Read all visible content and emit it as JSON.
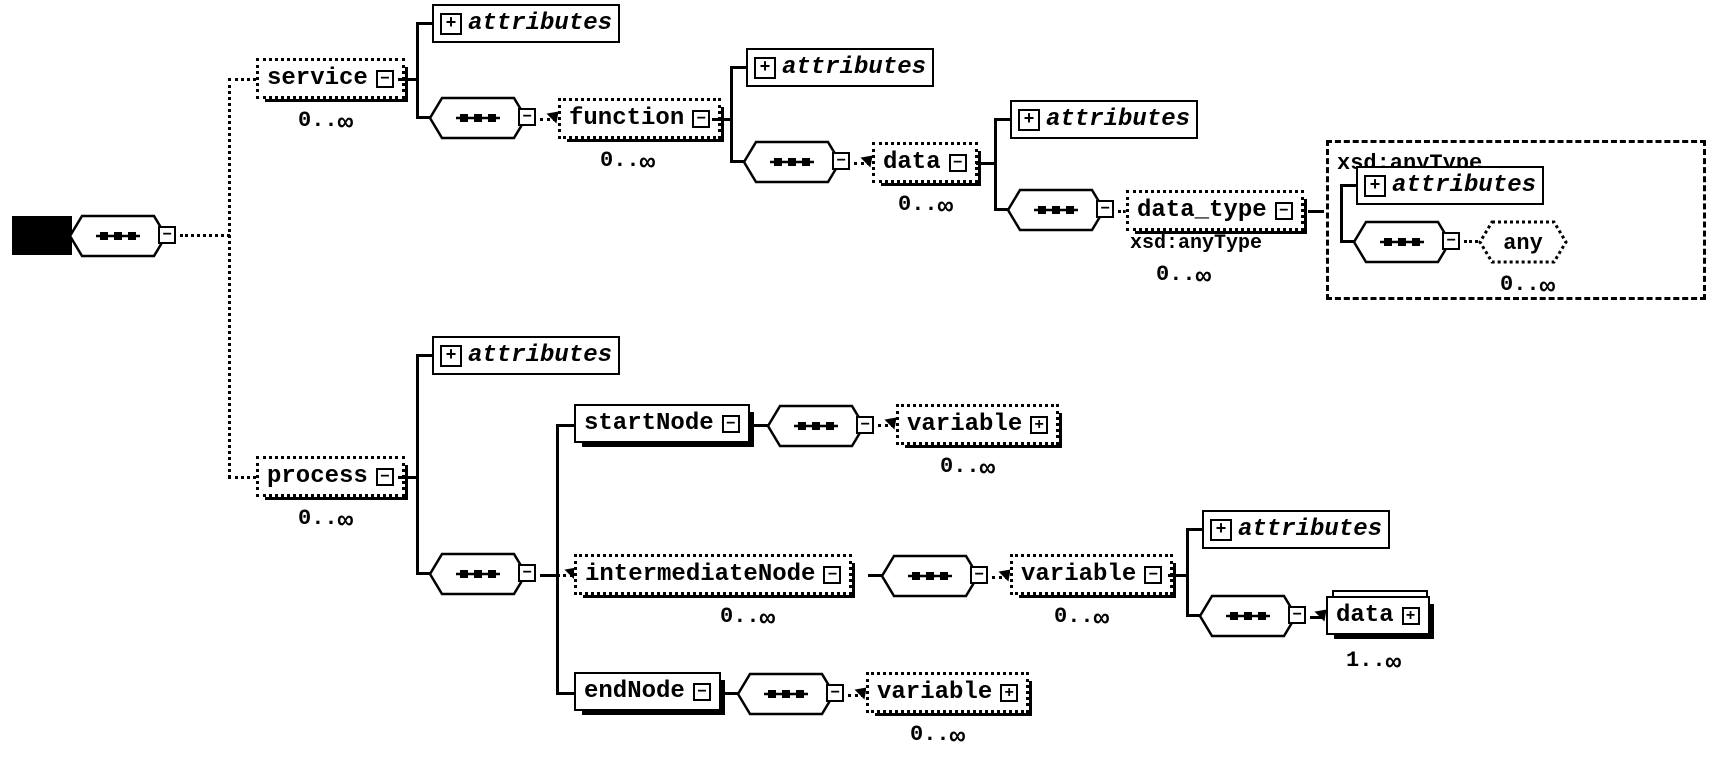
{
  "root": "",
  "nodes": {
    "service": "service",
    "function": "function",
    "data": "data",
    "data_type": "data_type",
    "process": "process",
    "startNode": "startNode",
    "intermediateNode": "intermediateNode",
    "endNode": "endNode",
    "variable": "variable",
    "any": "any",
    "data2": "data"
  },
  "attributes_label": "attributes",
  "anytype_label": "xsd:anyType",
  "cardinality": {
    "zero_inf": "0..",
    "one_inf": "1.."
  },
  "infinity": "∞"
}
